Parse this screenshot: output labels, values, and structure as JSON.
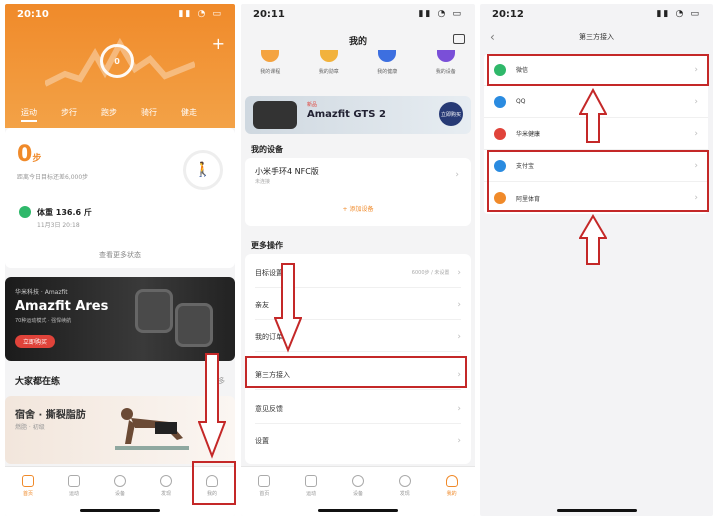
{
  "phone1": {
    "time": "20:10",
    "ring_label": "0",
    "tabs": [
      "运动",
      "步行",
      "跑步",
      "骑行",
      "健走"
    ],
    "steps_value": "0",
    "steps_unit": "步",
    "steps_text": "距离今日目标还差6,000步",
    "weight_label": "体重 136.6 斤",
    "weight_date": "11月3日 20:18",
    "more_link": "查看更多状态",
    "banner_small": "华米科技 · Amazfit",
    "banner_title": "Amazfit Ares",
    "banner_sub": "70种运动模式 · 强悍续航",
    "banner_btn": "立即购买",
    "section_label": "大家都在练",
    "section_more": "更多",
    "fit_title": "宿舍 · 撕裂脂肪",
    "fit_sub": "燃脂 · 初级",
    "tabbar": [
      "首页",
      "运动",
      "设备",
      "发现",
      "我的"
    ]
  },
  "phone2": {
    "time": "20:11",
    "title": "我的",
    "top_icons": [
      "我的课程",
      "我的勋章",
      "我的健康",
      "我的设备"
    ],
    "banner_tag": "新品",
    "banner_title": "Amazfit GTS 2",
    "banner_btn": "立即购买",
    "devices_label": "我的设备",
    "device_name": "小米手环4 NFC版",
    "device_status": "未连接",
    "add_device": "+ 添加设备",
    "more_label": "更多操作",
    "rows": [
      {
        "label": "目标设置",
        "meta": "6000步 / 未设置"
      },
      {
        "label": "亲友",
        "meta": ""
      },
      {
        "label": "我的订单",
        "meta": ""
      },
      {
        "label": "第三方接入",
        "meta": ""
      },
      {
        "label": "意见反馈",
        "meta": ""
      },
      {
        "label": "设置",
        "meta": ""
      }
    ],
    "tabbar": [
      "首页",
      "运动",
      "设备",
      "发现",
      "我的"
    ]
  },
  "phone3": {
    "time": "20:12",
    "title": "第三方接入",
    "items": [
      {
        "label": "微信",
        "color": "#2fb86a"
      },
      {
        "label": "QQ",
        "color": "#2a8be0"
      },
      {
        "label": "华米健康",
        "color": "#e0433a"
      },
      {
        "label": "支付宝",
        "color": "#2a8be0"
      },
      {
        "label": "阿里体育",
        "color": "#f08a2a"
      }
    ]
  },
  "colors": {
    "accent": "#f08a2a",
    "annotation": "#c42828"
  }
}
